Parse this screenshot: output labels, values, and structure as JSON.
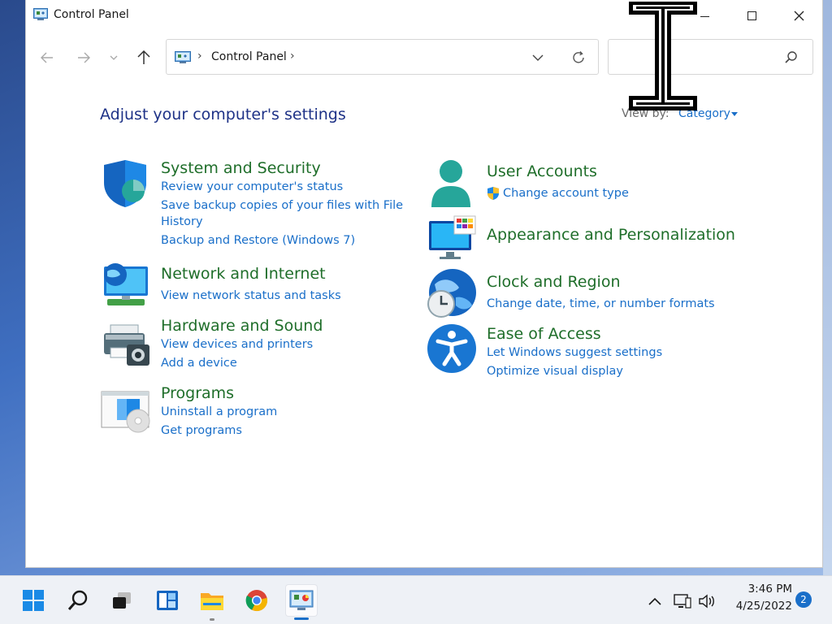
{
  "window": {
    "title": "Control Panel",
    "minimize_icon": "minimize-icon",
    "maximize_icon": "maximize-icon",
    "close_icon": "close-icon"
  },
  "nav": {
    "back_icon": "arrow-left-icon",
    "forward_icon": "arrow-right-icon",
    "recent_icon": "chevron-down-icon",
    "up_icon": "arrow-up-icon"
  },
  "address_bar": {
    "separator": "›",
    "location": "Control Panel",
    "dropdown_icon": "chevron-down-icon",
    "refresh_icon": "refresh-icon"
  },
  "search": {
    "value": "",
    "icon": "search-icon"
  },
  "content": {
    "heading": "Adjust your computer's settings",
    "view_by_label": "View by:",
    "view_by_value": "Category"
  },
  "categories": {
    "system_security": {
      "title": "System and Security",
      "links": [
        "Review your computer's status",
        "Save backup copies of your files with File",
        "History",
        "Backup and Restore (Windows 7)"
      ]
    },
    "network": {
      "title": "Network and Internet",
      "links": [
        "View network status and tasks"
      ]
    },
    "hardware": {
      "title": "Hardware and Sound",
      "links": [
        "View devices and printers",
        "Add a device"
      ]
    },
    "programs": {
      "title": "Programs",
      "links": [
        "Uninstall a program",
        "Get programs"
      ]
    },
    "user_accounts": {
      "title": "User Accounts",
      "links": [
        "Change account type"
      ]
    },
    "appearance": {
      "title": "Appearance and Personalization",
      "links": []
    },
    "clock_region": {
      "title": "Clock and Region",
      "links": [
        "Change date, time, or number formats"
      ]
    },
    "ease_access": {
      "title": "Ease of Access",
      "links": [
        "Let Windows suggest settings",
        "Optimize visual display"
      ]
    }
  },
  "taskbar": {
    "items": [
      "start-icon",
      "search-icon",
      "task-view-icon",
      "widgets-icon",
      "file-explorer-icon",
      "chrome-icon",
      "control-panel-icon"
    ],
    "tray": [
      "chevron-up-icon",
      "network-icon",
      "volume-icon"
    ],
    "time": "3:46 PM",
    "date": "4/25/2022",
    "notifications": "2"
  },
  "colors": {
    "heading": "#1e3287",
    "category_title": "#1f6e2a",
    "link": "#1a6fc9",
    "accent": "#1a6fc9"
  }
}
